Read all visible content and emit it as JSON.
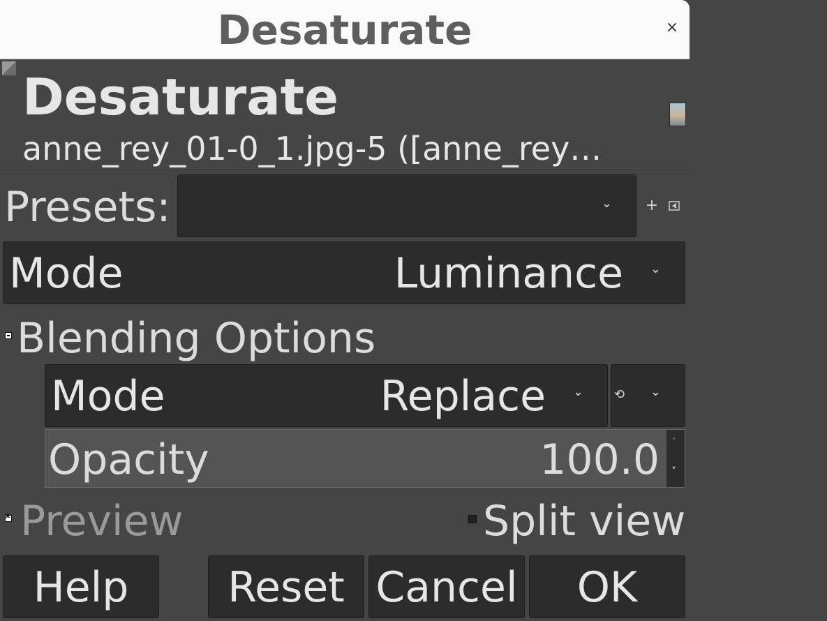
{
  "window": {
    "title": "Desaturate",
    "close_icon": "close-icon"
  },
  "header": {
    "title": "Desaturate",
    "subtitle": "anne_rey_01-0_1.jpg-5 ([anne_rey…",
    "corner_icon": "gimp-wilber-icon",
    "thumbnail_icon": "image-thumbnail"
  },
  "presets": {
    "label": "Presets:",
    "value": "",
    "add_icon": "plus-icon",
    "menu_icon": "menu-arrow-icon"
  },
  "mode": {
    "label": "Mode",
    "value": "Luminance"
  },
  "blending": {
    "section_label": "Blending Options",
    "expanded": true,
    "mode": {
      "label": "Mode",
      "value": "Replace"
    },
    "composite_icon": "reset-composite-icon",
    "opacity": {
      "label": "Opacity",
      "value": "100.0"
    }
  },
  "preview": {
    "label": "Preview",
    "checked": true
  },
  "split_view": {
    "label": "Split view",
    "checked": false
  },
  "buttons": {
    "help": "Help",
    "reset": "Reset",
    "cancel": "Cancel",
    "ok": "OK"
  },
  "colors": {
    "bg": "#454545",
    "field": "#2c2c2c",
    "titlebar": "#fafafa"
  }
}
